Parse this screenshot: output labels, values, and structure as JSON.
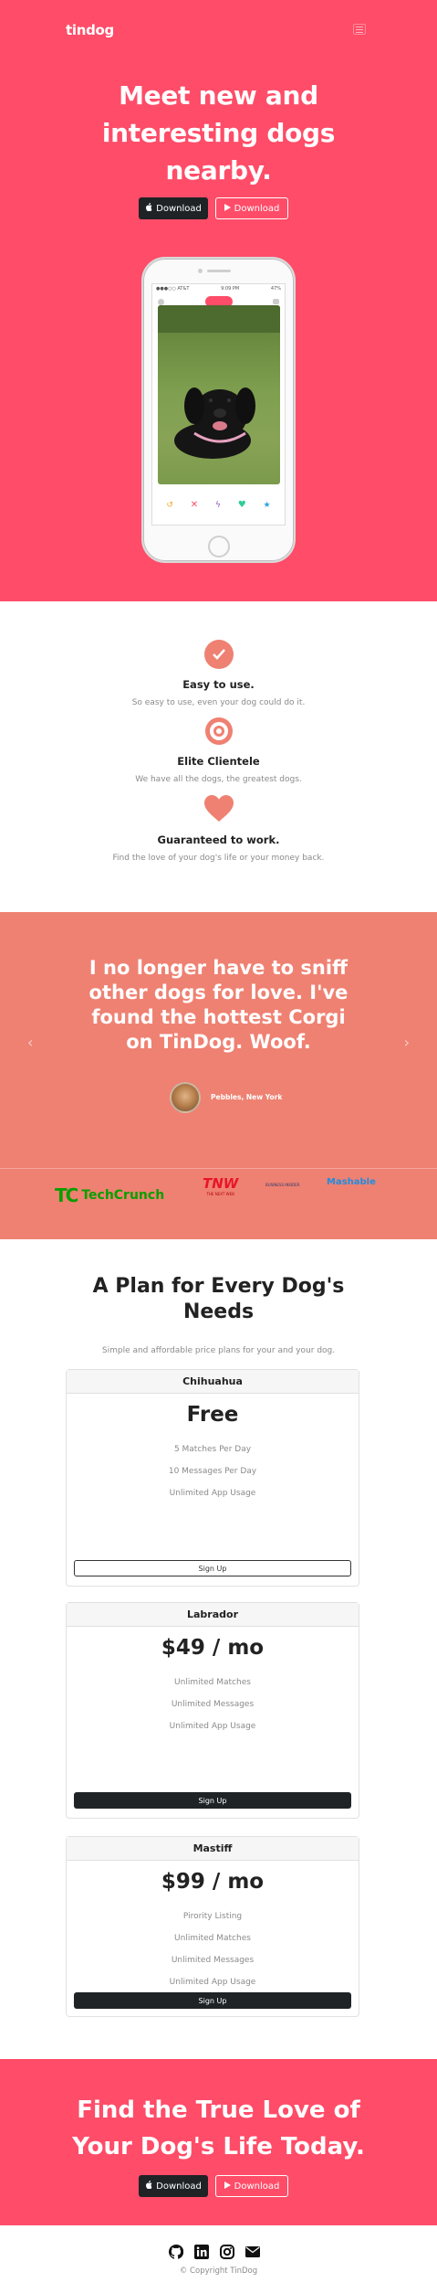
{
  "nav": {
    "brand": "tindog"
  },
  "hero": {
    "title_lines": [
      "Meet new and",
      "interesting dogs",
      "nearby."
    ],
    "download_apple": "Download",
    "download_play": "Download"
  },
  "phone": {
    "carrier": "●●●○○ AT&T",
    "time": "9:09 PM",
    "battery": "47%"
  },
  "features": [
    {
      "title": "Easy to use.",
      "text": "So easy to use, even your dog could do it.",
      "icon": "check-circle-icon"
    },
    {
      "title": "Elite Clientele",
      "text": "We have all the dogs, the greatest dogs.",
      "icon": "bullseye-icon"
    },
    {
      "title": "Guaranteed to work.",
      "text": "Find the love of your dog's life or your money back.",
      "icon": "heart-icon"
    }
  ],
  "testimonial": {
    "quote_lines": [
      "I no longer have to sniff",
      "other dogs for love. I've",
      "found the hottest Corgi",
      "on TinDog. Woof."
    ],
    "author": "Pebbles, New York"
  },
  "press": {
    "techcrunch": "TechCrunch",
    "tnw": "TNW",
    "tnw_sub": "THE NEXT WEB",
    "bi": "BUSINESS INSIDER",
    "mashable": "Mashable"
  },
  "pricing": {
    "title_lines": [
      "A Plan for Every Dog's",
      "Needs"
    ],
    "subtitle": "Simple and affordable price plans for your and your dog.",
    "plans": [
      {
        "name": "Chihuahua",
        "price": "Free",
        "features": [
          "5 Matches Per Day",
          "10 Messages Per Day",
          "Unlimited App Usage"
        ],
        "button": "Sign Up"
      },
      {
        "name": "Labrador",
        "price": "$49 / mo",
        "features": [
          "Unlimited Matches",
          "Unlimited Messages",
          "Unlimited App Usage"
        ],
        "button": "Sign Up"
      },
      {
        "name": "Mastiff",
        "price": "$99 / mo",
        "features": [
          "Pirority Listing",
          "Unlimited Matches",
          "Unlimited Messages",
          "Unlimited App Usage"
        ],
        "button": "Sign Up"
      }
    ]
  },
  "cta": {
    "title_lines": [
      "Find the True Love of",
      "Your Dog's Life Today."
    ],
    "download_apple": "Download",
    "download_play": "Download"
  },
  "footer": {
    "copyright": "© Copyright TinDog"
  },
  "colors": {
    "hero": "#ff4c68",
    "testimonial": "#ef8172",
    "dark": "#1f2326"
  }
}
